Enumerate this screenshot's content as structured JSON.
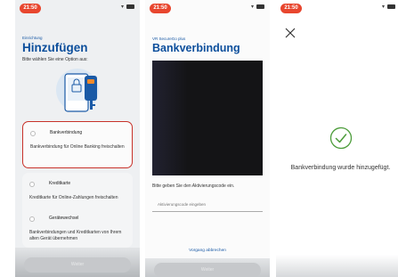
{
  "status_bar": {
    "time": "21:50"
  },
  "screen1": {
    "eyebrow": "Einrichtung",
    "title": "Hinzufügen",
    "subtitle": "Bitte wählen Sie eine Option aus:",
    "options": [
      {
        "title": "Bankverbindung",
        "description": "Bankverbindung für Online Banking freischalten",
        "selected": true
      },
      {
        "title": "Kreditkarte",
        "description": "Kreditkarte für Online-Zahlungen freischalten",
        "selected": false
      },
      {
        "title": "Gerätewechsel",
        "description": "Bankverbindungen und Kreditkarten von Ihrem alten Gerät übernehmen",
        "selected": false
      }
    ],
    "button_label": "Weiter"
  },
  "screen2": {
    "eyebrow": "VR SecureGo plus",
    "title": "Bankverbindung",
    "instruction": "Bitte geben Sie den Aktivierungscode ein.",
    "input_placeholder": "Aktivierungscode eingeben",
    "cancel_label": "Vorgang abbrechen",
    "button_label": "Weiter"
  },
  "screen3": {
    "message": "Bankverbindung wurde hinzugefügt."
  },
  "colors": {
    "accent": "#0d4f9c",
    "selected_border": "#c8322a",
    "success": "#4c9c3a",
    "time_pill": "#e8462e"
  }
}
